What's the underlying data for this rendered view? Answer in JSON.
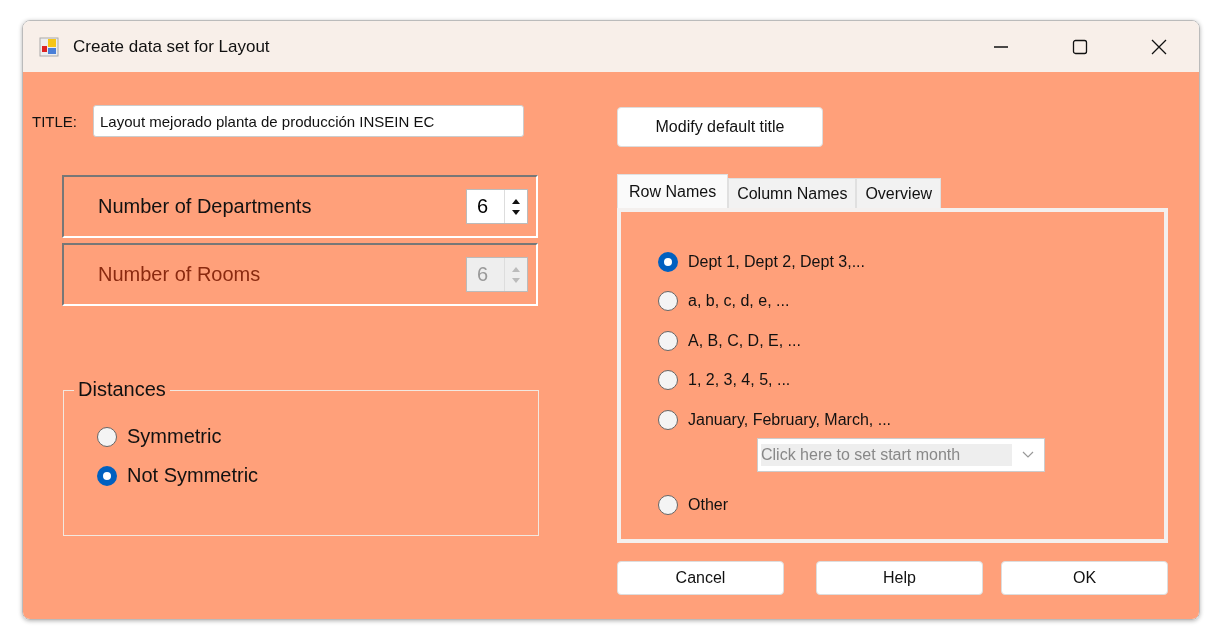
{
  "window": {
    "title": "Create data set for Layout"
  },
  "title_field": {
    "label": "TITLE:",
    "value": "Layout mejorado planta de producción INSEIN EC"
  },
  "modify_button": "Modify default title",
  "counts": [
    {
      "label": "Number of Departments",
      "value": "6",
      "disabled": false
    },
    {
      "label": "Number of Rooms",
      "value": "6",
      "disabled": true
    }
  ],
  "distances": {
    "title": "Distances",
    "options": [
      {
        "label": "Symmetric",
        "selected": false
      },
      {
        "label": "Not Symmetric",
        "selected": true
      }
    ]
  },
  "tabs": [
    {
      "label": "Row Names",
      "selected": true
    },
    {
      "label": "Column Names",
      "selected": false
    },
    {
      "label": "Overview",
      "selected": false
    }
  ],
  "row_name_options": [
    {
      "label": "Dept 1, Dept 2, Dept 3,...",
      "selected": true
    },
    {
      "label": "a, b, c, d, e, ...",
      "selected": false
    },
    {
      "label": "A, B, C, D, E, ...",
      "selected": false
    },
    {
      "label": "1, 2, 3, 4, 5, ...",
      "selected": false
    },
    {
      "label": "January, February, March, ...",
      "selected": false
    },
    {
      "label": "Other",
      "selected": false
    }
  ],
  "start_month": {
    "placeholder": "Click here to set start month",
    "disabled": true
  },
  "buttons": [
    "Cancel",
    "Help",
    "OK"
  ]
}
